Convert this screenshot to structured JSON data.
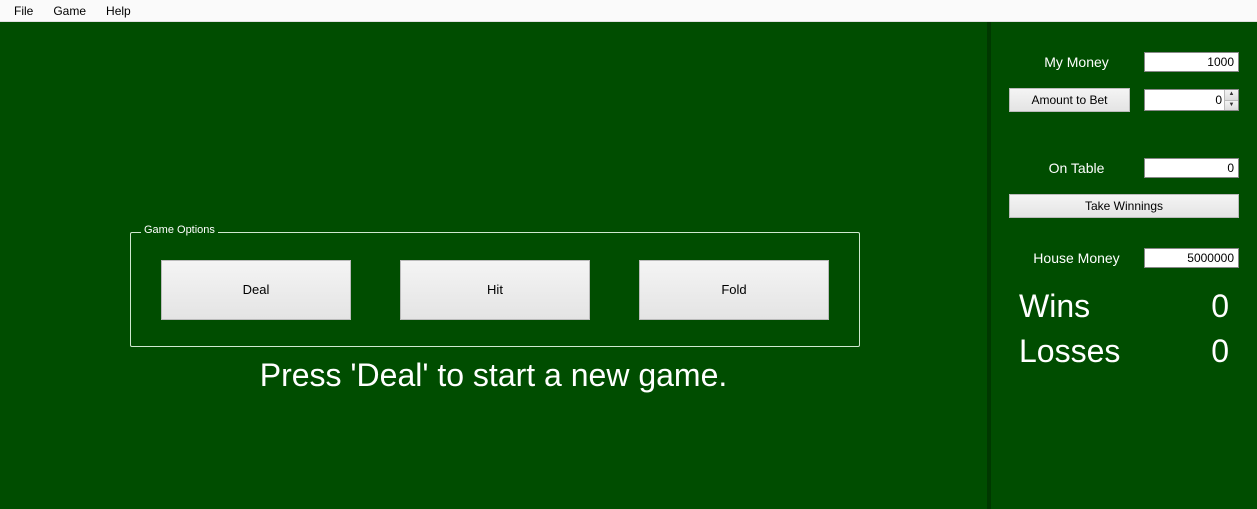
{
  "menu": {
    "file": "File",
    "game": "Game",
    "help": "Help"
  },
  "game_options": {
    "legend": "Game Options",
    "deal": "Deal",
    "hit": "Hit",
    "fold": "Fold"
  },
  "hint": "Press 'Deal' to start a new game.",
  "sidebar": {
    "my_money_label": "My Money",
    "my_money_value": "1000",
    "amount_to_bet_label": "Amount to Bet",
    "amount_to_bet_value": "0",
    "on_table_label": "On Table",
    "on_table_value": "0",
    "take_winnings": "Take Winnings",
    "house_money_label": "House Money",
    "house_money_value": "5000000",
    "wins_label": "Wins",
    "wins_value": "0",
    "losses_label": "Losses",
    "losses_value": "0"
  }
}
